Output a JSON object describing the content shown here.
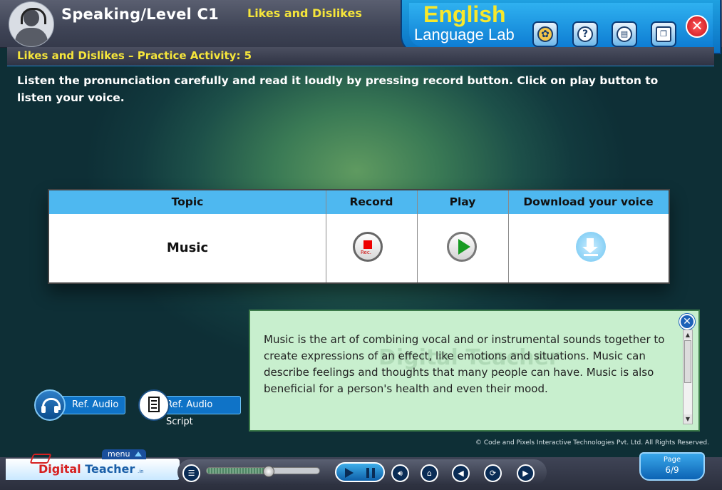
{
  "header": {
    "level_title": "Speaking/Level C1",
    "lesson_title": "Likes and Dislikes",
    "brand_line1": "English",
    "brand_line2": "Language Lab",
    "icons": [
      "certificate-icon",
      "help-icon",
      "book-icon",
      "window-icon"
    ],
    "close_label": "✕"
  },
  "activity": {
    "title": "Likes and Dislikes – Practice Activity: 5",
    "instruction": "Listen the pronunciation carefully and read it loudly by pressing record button. Click on play button to listen your voice."
  },
  "table": {
    "headers": [
      "Topic",
      "Record",
      "Play",
      "Download your voice"
    ],
    "rows": [
      {
        "topic": "Music",
        "record_label": "Rec."
      }
    ]
  },
  "script_panel": {
    "text": "Music is the art of combining vocal and or instrumental sounds together to create expressions of an effect, like emotions and situations. Music can describe feelings and thoughts that many people can have. Music is also beneficial for a person's health and even their mood.",
    "close_label": "✕",
    "watermark": "Digital Teacher"
  },
  "ref_buttons": {
    "audio_label": "Ref. Audio",
    "script_label": "Ref. Audio Script"
  },
  "footer": {
    "copyright": "© Code and Pixels Interactive Technologies  Pvt. Ltd. All Rights Reserved.",
    "logo_digital": "Digital",
    "logo_teacher": "Teacher",
    "logo_suffix": ".in",
    "menu_label": "menu",
    "progress": 0.55,
    "page_label": "Page",
    "page_number": "6/9"
  }
}
